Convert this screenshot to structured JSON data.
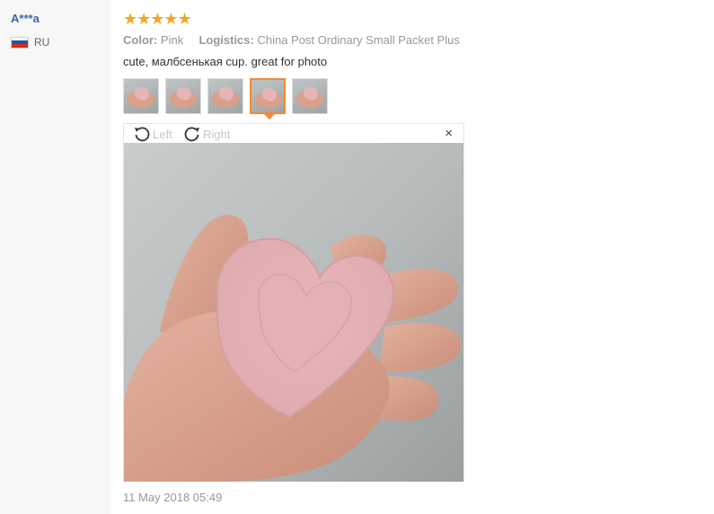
{
  "reviewer": {
    "name": "A***a",
    "country_code": "RU",
    "flag_colors": [
      "#ffffff",
      "#1c57a7",
      "#d52b1e"
    ]
  },
  "review": {
    "rating_stars": 5,
    "star_glyphs": "★★★★★",
    "color_label": "Color:",
    "color_value": "Pink",
    "logistics_label": "Logistics:",
    "logistics_value": "China Post Ordinary Small Packet Plus",
    "text": "cute, малбсенькая cup. great for photo",
    "date": "11 May 2018 05:49",
    "thumbnails_count": 5,
    "active_thumbnail": 4
  },
  "viewer": {
    "rotate_left_label": "Left",
    "rotate_right_label": "Right",
    "close_symbol": "×"
  },
  "colors": {
    "star": "#f5a623",
    "link": "#3a66ad",
    "active_border": "#f38a36",
    "dish_pink": "#e8b5b7"
  }
}
